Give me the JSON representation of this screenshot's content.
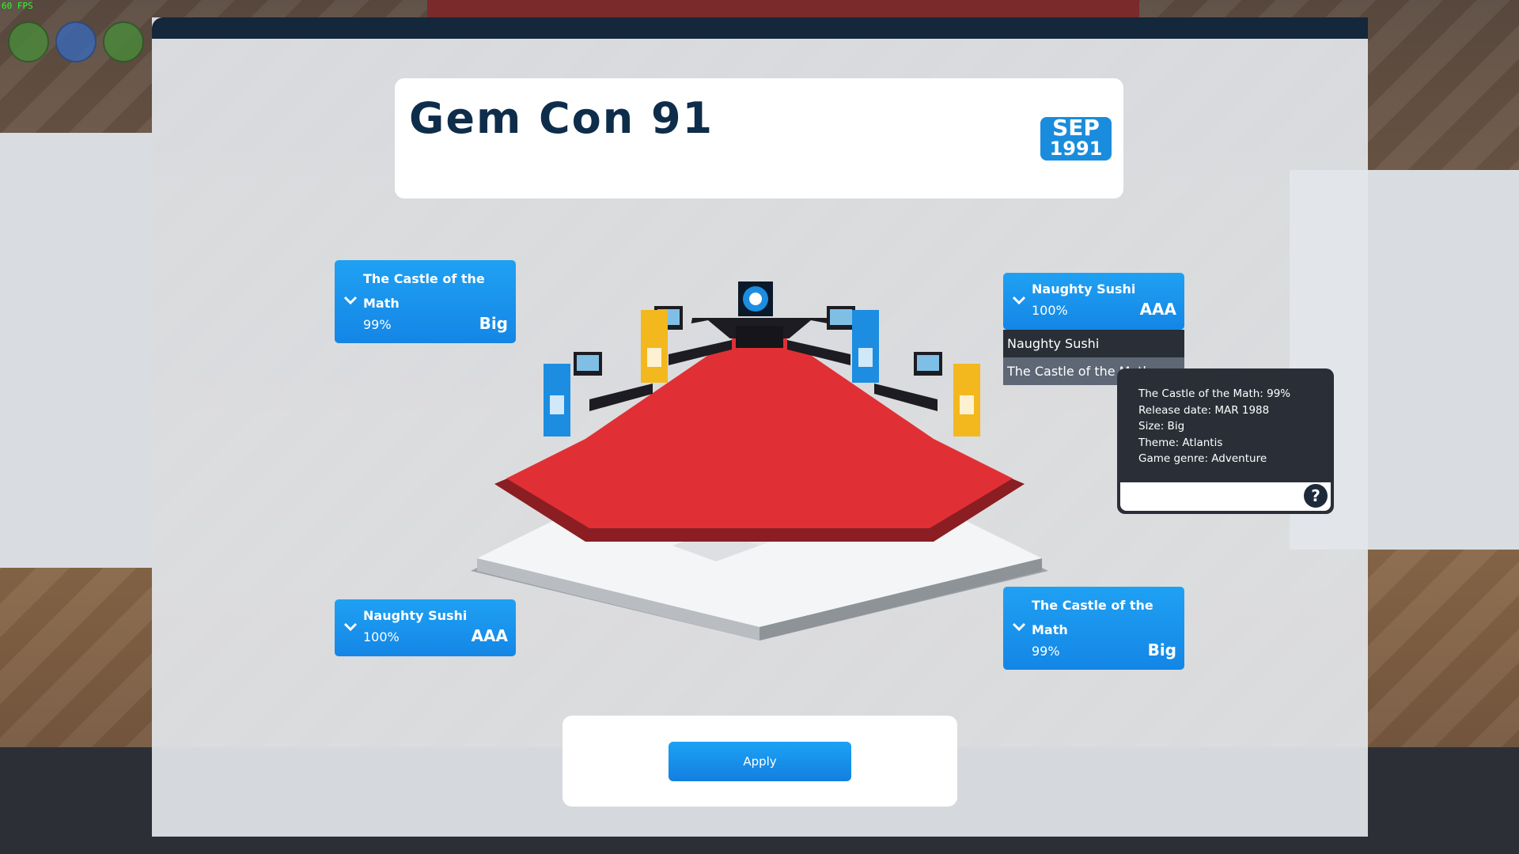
{
  "overlay": {
    "fps": "60 FPS"
  },
  "event": {
    "title": "Gem Con 91",
    "date": {
      "month": "SEP",
      "year": "1991"
    }
  },
  "slots": {
    "top_left": {
      "game": "The Castle of the Math",
      "rating": "99%",
      "size": "Big"
    },
    "top_right": {
      "game": "Naughty Sushi",
      "rating": "100%",
      "size": "AAA"
    },
    "bottom_left": {
      "game": "Naughty Sushi",
      "rating": "100%",
      "size": "AAA"
    },
    "bottom_right": {
      "game": "The Castle of the Math",
      "rating": "99%",
      "size": "Big"
    }
  },
  "dropdown": {
    "options": [
      "Naughty Sushi",
      "The Castle of the Math"
    ]
  },
  "tooltip": {
    "lines": [
      "The Castle of the Math: 99%",
      "Release date: MAR 1988",
      "Size: Big",
      "Theme: Atlantis",
      "Game genre: Adventure"
    ],
    "help": "?"
  },
  "actions": {
    "apply": "Apply"
  },
  "colors": {
    "accent": "#1a8cdd",
    "title": "#0e2d4b",
    "carpet": "#e03035",
    "banner_yellow": "#f2b81e",
    "banner_blue": "#1c8de0"
  },
  "icons": {
    "chevron": "chevron-down-icon",
    "help": "help-icon",
    "logo": "company-logo-icon"
  }
}
